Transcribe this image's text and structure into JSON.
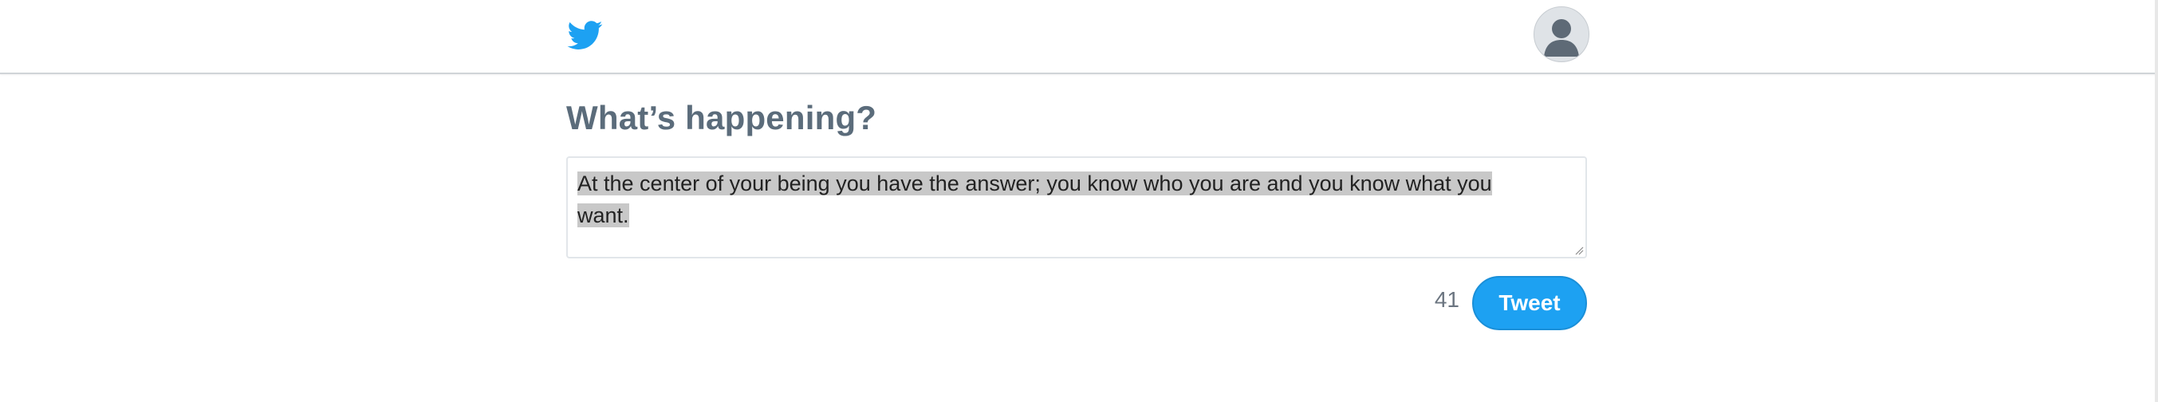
{
  "header": {
    "logo_icon": "twitter-bird-icon",
    "avatar_icon": "default-user-avatar-icon",
    "brand_color": "#1da1f2"
  },
  "composer": {
    "heading": "What’s happening?",
    "text_line1": "At the center of your being you have the answer; you know who you are and you know what you ",
    "text_line2": "want. ",
    "selected": true,
    "remaining_count": "41",
    "submit_label": "Tweet"
  }
}
